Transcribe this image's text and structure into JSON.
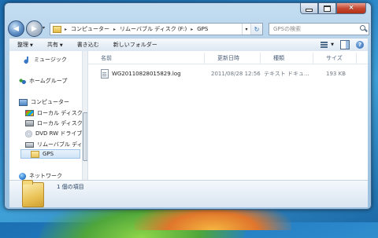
{
  "window": {
    "caption_buttons": {
      "minimize": "minimize-icon",
      "maximize": "maximize-icon",
      "close": "×"
    }
  },
  "nav": {
    "back_glyph": "◀",
    "forward_glyph": "▶",
    "dropdown_glyph": "▾",
    "breadcrumb": [
      "コンピューター",
      "リムーバブル ディスク (F:)",
      "GPS"
    ],
    "crumb_sep": "▸",
    "address_dropdown": "▾",
    "refresh_glyph": "↻",
    "search_placeholder": "GPSの検索"
  },
  "commandbar": {
    "organize": "整理",
    "share": "共有",
    "burn": "書き込む",
    "new_folder": "新しいフォルダー",
    "arrow": "▼",
    "help": "?"
  },
  "sidebar": {
    "items": [
      {
        "label": "ミュージック",
        "icon": "music-icon"
      },
      {
        "label": "ホームグループ",
        "icon": "homegroup-icon"
      },
      {
        "label": "コンピューター",
        "icon": "computer-icon"
      },
      {
        "label": "ローカル ディスク",
        "icon": "local-disk-icon"
      },
      {
        "label": "ローカル ディスク",
        "icon": "local-disk-icon"
      },
      {
        "label": "DVD RW ドライブ",
        "icon": "dvd-drive-icon"
      },
      {
        "label": "リムーバブル ディス",
        "icon": "removable-disk-icon"
      },
      {
        "label": "GPS",
        "icon": "folder-icon"
      },
      {
        "label": "ネットワーク",
        "icon": "network-icon"
      }
    ]
  },
  "files": {
    "columns": [
      "名前",
      "更新日時",
      "種類",
      "サイズ"
    ],
    "rows": [
      {
        "name": "WG20110828015829.log",
        "modified": "2011/08/28 12:56",
        "type": "テキスト ドキュ...",
        "size": "193 KB"
      }
    ]
  },
  "details": {
    "item_count": "1 個の項目"
  }
}
